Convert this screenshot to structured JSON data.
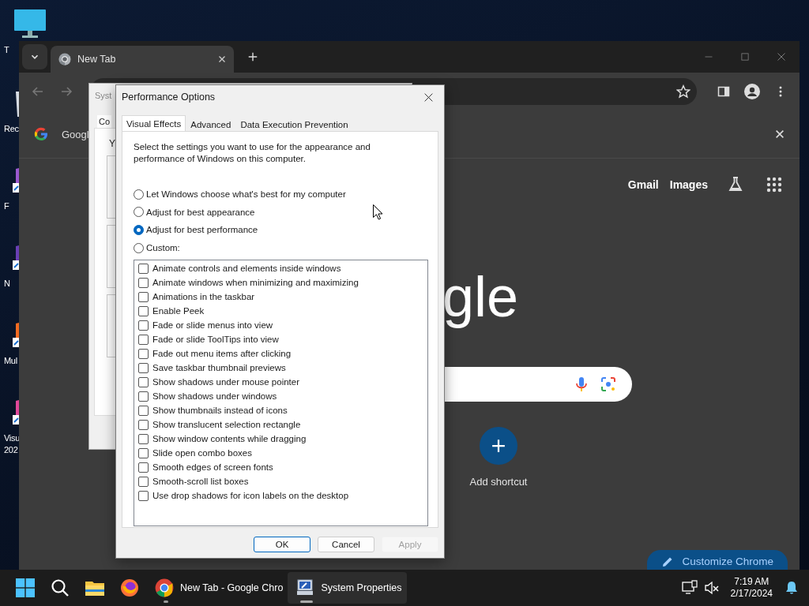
{
  "desktop_icons": [
    {
      "kind": "monitor",
      "label": "T"
    },
    {
      "kind": "bin",
      "label": "Rec"
    },
    {
      "kind": "app",
      "label": "F"
    },
    {
      "kind": "app",
      "label": "N"
    },
    {
      "kind": "app",
      "label": "Mul"
    },
    {
      "kind": "app",
      "label": "Visu 202"
    }
  ],
  "browser": {
    "tabs": [
      {
        "label": "New Tab",
        "selected": true
      }
    ],
    "info_bar": {
      "text": "Googl"
    },
    "header_links": [
      "Gmail",
      "Images"
    ],
    "logo_text": "gle",
    "shortcut": {
      "label": "Add shortcut"
    },
    "customize_button": "Customize Chrome"
  },
  "system_properties": {
    "title": "Syst",
    "tab": "Co",
    "intro": "Y"
  },
  "performance_options": {
    "title": "Performance Options",
    "tabs": [
      {
        "label": "Visual Effects",
        "selected": true
      },
      {
        "label": "Advanced",
        "selected": false
      },
      {
        "label": "Data Execution Prevention",
        "selected": false
      }
    ],
    "description": "Select the settings you want to use for the appearance and performance of Windows on this computer.",
    "radios": [
      {
        "label": "Let Windows choose what's best for my computer",
        "selected": false
      },
      {
        "label": "Adjust for best appearance",
        "selected": false
      },
      {
        "label": "Adjust for best performance",
        "selected": true
      },
      {
        "label": "Custom:",
        "selected": false
      }
    ],
    "effects": [
      {
        "label": "Animate controls and elements inside windows",
        "checked": false
      },
      {
        "label": "Animate windows when minimizing and maximizing",
        "checked": false
      },
      {
        "label": "Animations in the taskbar",
        "checked": false
      },
      {
        "label": "Enable Peek",
        "checked": false
      },
      {
        "label": "Fade or slide menus into view",
        "checked": false
      },
      {
        "label": "Fade or slide ToolTips into view",
        "checked": false
      },
      {
        "label": "Fade out menu items after clicking",
        "checked": false
      },
      {
        "label": "Save taskbar thumbnail previews",
        "checked": false
      },
      {
        "label": "Show shadows under mouse pointer",
        "checked": false
      },
      {
        "label": "Show shadows under windows",
        "checked": false
      },
      {
        "label": "Show thumbnails instead of icons",
        "checked": false
      },
      {
        "label": "Show translucent selection rectangle",
        "checked": false
      },
      {
        "label": "Show window contents while dragging",
        "checked": false
      },
      {
        "label": "Slide open combo boxes",
        "checked": false
      },
      {
        "label": "Smooth edges of screen fonts",
        "checked": false
      },
      {
        "label": "Smooth-scroll list boxes",
        "checked": false
      },
      {
        "label": "Use drop shadows for icon labels on the desktop",
        "checked": false
      }
    ],
    "buttons": [
      {
        "label": "OK",
        "kind": "default",
        "disabled": false
      },
      {
        "label": "Cancel",
        "kind": "normal",
        "disabled": false
      },
      {
        "label": "Apply",
        "kind": "normal",
        "disabled": true
      }
    ]
  },
  "taskbar": {
    "items": [
      {
        "kind": "start",
        "running": false,
        "selected": false
      },
      {
        "kind": "search",
        "running": false,
        "selected": false
      },
      {
        "kind": "explorer",
        "running": false,
        "selected": false
      },
      {
        "kind": "firefox",
        "running": false,
        "selected": false
      },
      {
        "kind": "chrome",
        "label": "New Tab - Google Chro",
        "running": true,
        "selected": false
      },
      {
        "kind": "sysprops",
        "label": "System Properties",
        "running": true,
        "selected": true
      }
    ],
    "time": "7:19 AM",
    "date": "2/17/2024"
  }
}
